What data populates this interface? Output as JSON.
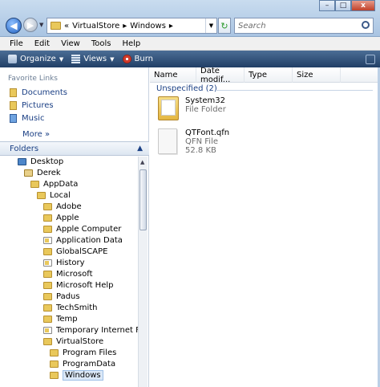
{
  "window": {
    "controls": {
      "minimize": "–",
      "maximize": "□",
      "close": "x"
    }
  },
  "nav": {
    "back_glyph": "◀",
    "forward_glyph": "▶",
    "address": {
      "prefix": "«",
      "crumbs": [
        "VirtualStore",
        "Windows"
      ],
      "separator": "▸"
    },
    "refresh_glyph": "↻",
    "search_placeholder": "Search"
  },
  "menu": [
    "File",
    "Edit",
    "View",
    "Tools",
    "Help"
  ],
  "commands": [
    {
      "label": "Organize",
      "icon": "organize-icon"
    },
    {
      "label": "Views",
      "icon": "views-icon"
    },
    {
      "label": "Burn",
      "icon": "burn-icon"
    }
  ],
  "favorites": {
    "header": "Favorite Links",
    "items": [
      {
        "label": "Documents",
        "icon": "documents-icon"
      },
      {
        "label": "Pictures",
        "icon": "pictures-icon"
      },
      {
        "label": "Music",
        "icon": "music-icon"
      }
    ],
    "more": "More  »"
  },
  "folders": {
    "header": "Folders",
    "tree": [
      {
        "label": "Desktop",
        "depth": 0,
        "kind": "desk"
      },
      {
        "label": "Derek",
        "depth": 1,
        "kind": "user"
      },
      {
        "label": "AppData",
        "depth": 2,
        "kind": "folder"
      },
      {
        "label": "Local",
        "depth": 3,
        "kind": "folder"
      },
      {
        "label": "Adobe",
        "depth": 4,
        "kind": "folder"
      },
      {
        "label": "Apple",
        "depth": 4,
        "kind": "folder"
      },
      {
        "label": "Apple Computer",
        "depth": 4,
        "kind": "folder"
      },
      {
        "label": "Application Data",
        "depth": 4,
        "kind": "sys"
      },
      {
        "label": "GlobalSCAPE",
        "depth": 4,
        "kind": "folder"
      },
      {
        "label": "History",
        "depth": 4,
        "kind": "sys"
      },
      {
        "label": "Microsoft",
        "depth": 4,
        "kind": "folder"
      },
      {
        "label": "Microsoft Help",
        "depth": 4,
        "kind": "folder"
      },
      {
        "label": "Padus",
        "depth": 4,
        "kind": "folder"
      },
      {
        "label": "TechSmith",
        "depth": 4,
        "kind": "folder"
      },
      {
        "label": "Temp",
        "depth": 4,
        "kind": "folder"
      },
      {
        "label": "Temporary Internet Files",
        "depth": 4,
        "kind": "sys"
      },
      {
        "label": "VirtualStore",
        "depth": 4,
        "kind": "folder"
      },
      {
        "label": "Program Files",
        "depth": 5,
        "kind": "folder"
      },
      {
        "label": "ProgramData",
        "depth": 5,
        "kind": "folder"
      },
      {
        "label": "Windows",
        "depth": 5,
        "kind": "folder",
        "selected": true
      }
    ]
  },
  "list": {
    "columns": [
      "Name",
      "Date modif...",
      "Type",
      "Size"
    ],
    "group": "Unspecified (2)",
    "files": [
      {
        "name": "System32",
        "type": "File Folder",
        "size": "",
        "icon": "folder-icon"
      },
      {
        "name": "QTFont.qfn",
        "type": "QFN File",
        "size": "52.8 KB",
        "icon": "file-icon"
      }
    ]
  }
}
